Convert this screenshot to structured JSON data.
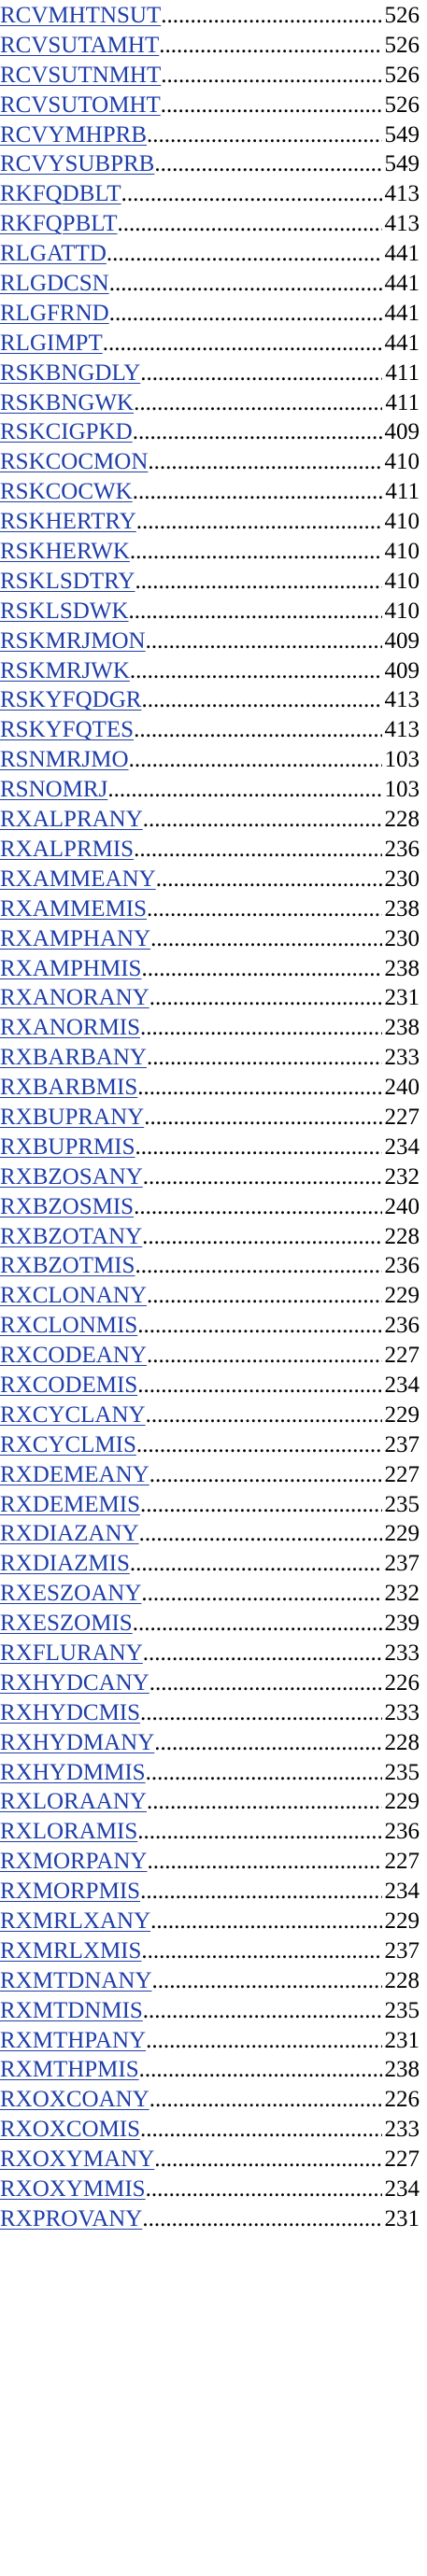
{
  "index": {
    "entries": [
      {
        "name": "RCVMHTNSUT",
        "page": "526"
      },
      {
        "name": "RCVSUTAMHT",
        "page": "526"
      },
      {
        "name": "RCVSUTNMHT",
        "page": "526"
      },
      {
        "name": "RCVSUTOMHT",
        "page": "526"
      },
      {
        "name": "RCVYMHPRB",
        "page": "549"
      },
      {
        "name": "RCVYSUBPRB",
        "page": "549"
      },
      {
        "name": "RKFQDBLT",
        "page": "413"
      },
      {
        "name": "RKFQPBLT",
        "page": "413"
      },
      {
        "name": "RLGATTD",
        "page": "441"
      },
      {
        "name": "RLGDCSN",
        "page": "441"
      },
      {
        "name": "RLGFRND",
        "page": "441"
      },
      {
        "name": "RLGIMPT",
        "page": "441"
      },
      {
        "name": "RSKBNGDLY",
        "page": "411"
      },
      {
        "name": "RSKBNGWK",
        "page": "411"
      },
      {
        "name": "RSKCIGPKD",
        "page": "409"
      },
      {
        "name": "RSKCOCMON",
        "page": "410"
      },
      {
        "name": "RSKCOCWK",
        "page": "411"
      },
      {
        "name": "RSKHERTRY",
        "page": "410"
      },
      {
        "name": "RSKHERWK",
        "page": "410"
      },
      {
        "name": "RSKLSDTRY",
        "page": "410"
      },
      {
        "name": "RSKLSDWK",
        "page": "410"
      },
      {
        "name": "RSKMRJMON",
        "page": "409"
      },
      {
        "name": "RSKMRJWK",
        "page": "409"
      },
      {
        "name": "RSKYFQDGR",
        "page": "413"
      },
      {
        "name": "RSKYFQTES",
        "page": "413"
      },
      {
        "name": "RSNMRJMO",
        "page": "103"
      },
      {
        "name": "RSNOMRJ",
        "page": "103"
      },
      {
        "name": "RXALPRANY",
        "page": "228"
      },
      {
        "name": "RXALPRMIS",
        "page": "236"
      },
      {
        "name": "RXAMMEANY",
        "page": "230"
      },
      {
        "name": "RXAMMEMIS",
        "page": "238"
      },
      {
        "name": "RXAMPHANY",
        "page": "230"
      },
      {
        "name": "RXAMPHMIS",
        "page": "238"
      },
      {
        "name": "RXANORANY",
        "page": "231"
      },
      {
        "name": "RXANORMIS",
        "page": "238"
      },
      {
        "name": "RXBARBANY",
        "page": "233"
      },
      {
        "name": "RXBARBMIS",
        "page": "240"
      },
      {
        "name": "RXBUPRANY",
        "page": "227"
      },
      {
        "name": "RXBUPRMIS",
        "page": "234"
      },
      {
        "name": "RXBZOSANY",
        "page": "232"
      },
      {
        "name": "RXBZOSMIS",
        "page": "240"
      },
      {
        "name": "RXBZOTANY",
        "page": "228"
      },
      {
        "name": "RXBZOTMIS",
        "page": "236"
      },
      {
        "name": "RXCLONANY",
        "page": "229"
      },
      {
        "name": "RXCLONMIS",
        "page": "236"
      },
      {
        "name": "RXCODEANY",
        "page": "227"
      },
      {
        "name": "RXCODEMIS",
        "page": "234"
      },
      {
        "name": "RXCYCLANY",
        "page": "229"
      },
      {
        "name": "RXCYCLMIS",
        "page": "237"
      },
      {
        "name": "RXDEMEANY",
        "page": "227"
      },
      {
        "name": "RXDEMEMIS",
        "page": "235"
      },
      {
        "name": "RXDIAZANY",
        "page": "229"
      },
      {
        "name": "RXDIAZMIS",
        "page": "237"
      },
      {
        "name": "RXESZOANY",
        "page": "232"
      },
      {
        "name": "RXESZOMIS",
        "page": "239"
      },
      {
        "name": "RXFLURANY",
        "page": "233"
      },
      {
        "name": "RXHYDCANY",
        "page": "226"
      },
      {
        "name": "RXHYDCMIS",
        "page": "233"
      },
      {
        "name": "RXHYDMANY",
        "page": "228"
      },
      {
        "name": "RXHYDMMIS",
        "page": "235"
      },
      {
        "name": "RXLORAANY",
        "page": "229"
      },
      {
        "name": "RXLORAMIS",
        "page": "236"
      },
      {
        "name": "RXMORPANY",
        "page": "227"
      },
      {
        "name": "RXMORPMIS",
        "page": "234"
      },
      {
        "name": "RXMRLXANY",
        "page": "229"
      },
      {
        "name": "RXMRLXMIS",
        "page": "237"
      },
      {
        "name": "RXMTDNANY",
        "page": "228"
      },
      {
        "name": "RXMTDNMIS",
        "page": "235"
      },
      {
        "name": "RXMTHPANY",
        "page": "231"
      },
      {
        "name": "RXMTHPMIS",
        "page": "238"
      },
      {
        "name": "RXOXCOANY",
        "page": "226"
      },
      {
        "name": "RXOXCOMIS",
        "page": "233"
      },
      {
        "name": "RXOXYMANY",
        "page": "227"
      },
      {
        "name": "RXOXYMMIS",
        "page": "234"
      },
      {
        "name": "RXPROVANY",
        "page": "231"
      }
    ]
  }
}
